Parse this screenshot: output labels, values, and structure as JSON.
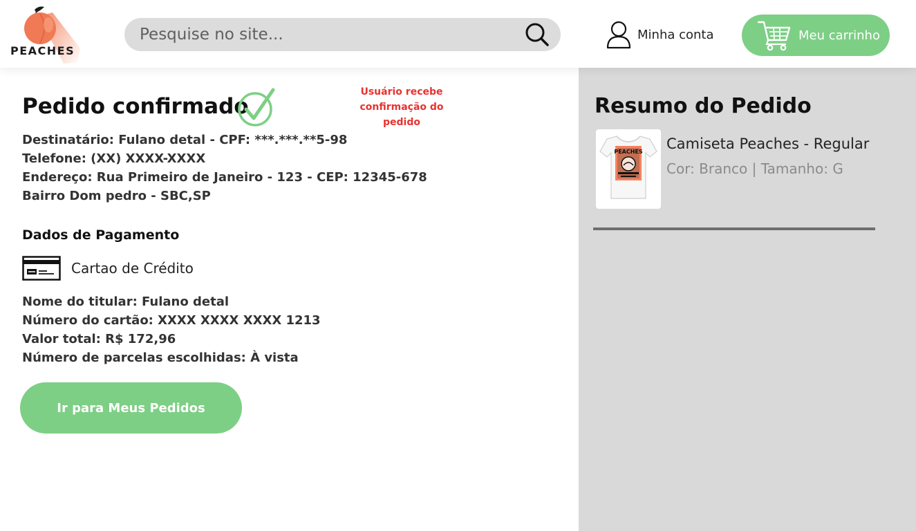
{
  "header": {
    "logo_text": "PEACHES",
    "search_placeholder": "Pesquise no site...",
    "account_label": "Minha conta",
    "cart_label": "Meu carrinho"
  },
  "order": {
    "title": "Pedido confirmado",
    "annotation": "Usuário recebe confirmação do pedido",
    "address_lines": [
      "Destinatário: Fulano detal - CPF: ***.***.**5-98",
      "Telefone: (XX) XXXX-XXXX",
      "Endereço: Rua Primeiro de Janeiro - 123 - CEP: 12345-678",
      "Bairro Dom pedro - SBC,SP"
    ]
  },
  "payment": {
    "title": "Dados de Pagamento",
    "method": "Cartao de Crédito",
    "details": [
      "Nome do titular: Fulano detal",
      "Número do cartão: XXXX XXXX XXXX 1213",
      "Valor total: R$ 172,96",
      "Número de parcelas escolhidas: À vista"
    ],
    "button_label": "Ir para Meus Pedidos"
  },
  "summary": {
    "title": "Resumo do Pedido",
    "product_name": "Camiseta Peaches - Regular",
    "product_meta": "Cor: Branco | Tamanho: G",
    "shirt_print_text": "PEACHES"
  },
  "colors": {
    "accent_green": "#7dcf85",
    "annotation_red": "#e8322f",
    "summary_bg": "#d9d9d9",
    "peach": "#f4845f"
  }
}
